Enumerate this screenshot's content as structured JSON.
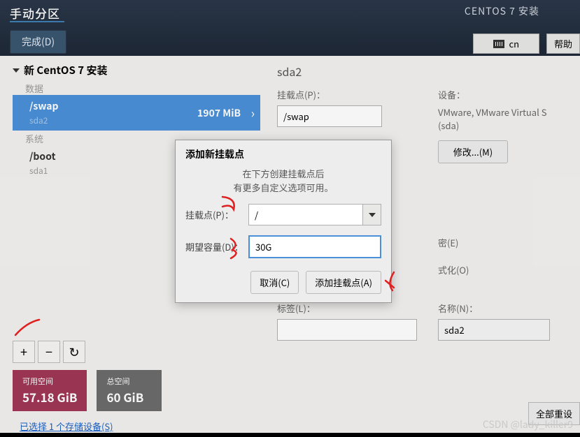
{
  "topbar": {
    "title": "手动分区",
    "done_label": "完成(D)",
    "install_title": "CENTOS 7 安装",
    "lang_label": "cn",
    "help_label": "帮助"
  },
  "left": {
    "install_header": "新 CentOS 7 安装",
    "section_data": "数据",
    "section_system": "系统",
    "swap": {
      "mount": "/swap",
      "dev": "sda2",
      "size": "1907 MiB"
    },
    "boot": {
      "mount": "/boot",
      "dev": "sda1"
    },
    "avail_label": "可用空间",
    "avail_value": "57.18 GiB",
    "total_label": "总空间",
    "total_value": "60 GiB",
    "storage_link": "已选择 1 个存储设备(S)"
  },
  "right": {
    "title": "sda2",
    "mount_label": "挂载点(P)：",
    "mount_value": "/swap",
    "device_label": "设备：",
    "device_value": "VMware, VMware Virtual S (sda)",
    "modify_label": "修改...(M)",
    "encrypt_label": "密(E)",
    "format_label": "式化(O)",
    "tag_label": "标签(L)：",
    "name_label": "名称(N)：",
    "name_value": "sda2",
    "reset_label": "全部重设"
  },
  "dialog": {
    "title": "添加新挂载点",
    "desc_line1": "在下方创建挂载点后",
    "desc_line2": "有更多自定义选项可用。",
    "mount_label": "挂载点(P)：",
    "mount_value": "/",
    "desired_label": "期望容量(D)：",
    "desired_value": "30G",
    "cancel_label": "取消(C)",
    "add_label": "添加挂载点(A)"
  },
  "watermark": "CSDN @lady_killer9"
}
